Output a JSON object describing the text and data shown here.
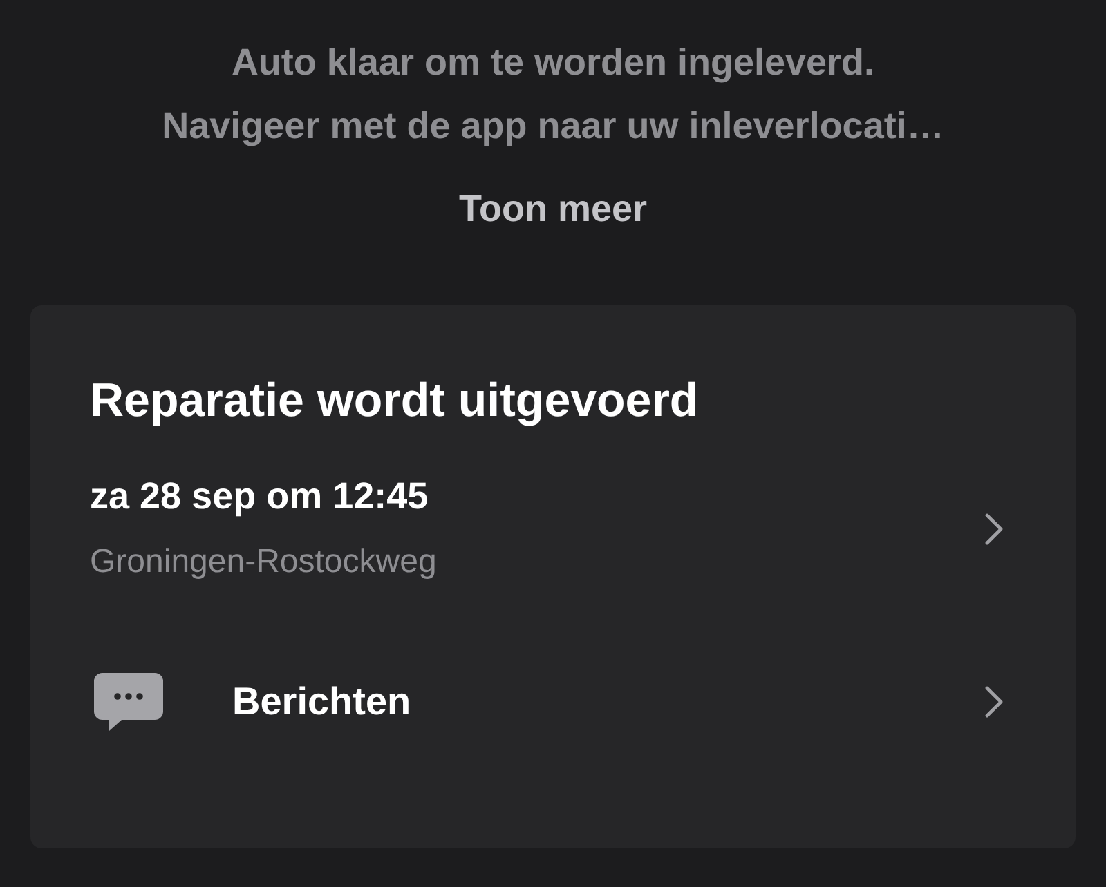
{
  "notice": {
    "lines": [
      "Auto klaar om te worden ingeleverd.",
      "Navigeer met de app naar uw inleverlocati…"
    ],
    "more_link": "Toon meer"
  },
  "card": {
    "title": "Reparatie wordt uitgevoerd",
    "appointment": {
      "datetime": "za 28 sep om 12:45",
      "location": "Groningen-Rostockweg"
    },
    "messages": {
      "label": "Berichten"
    }
  }
}
